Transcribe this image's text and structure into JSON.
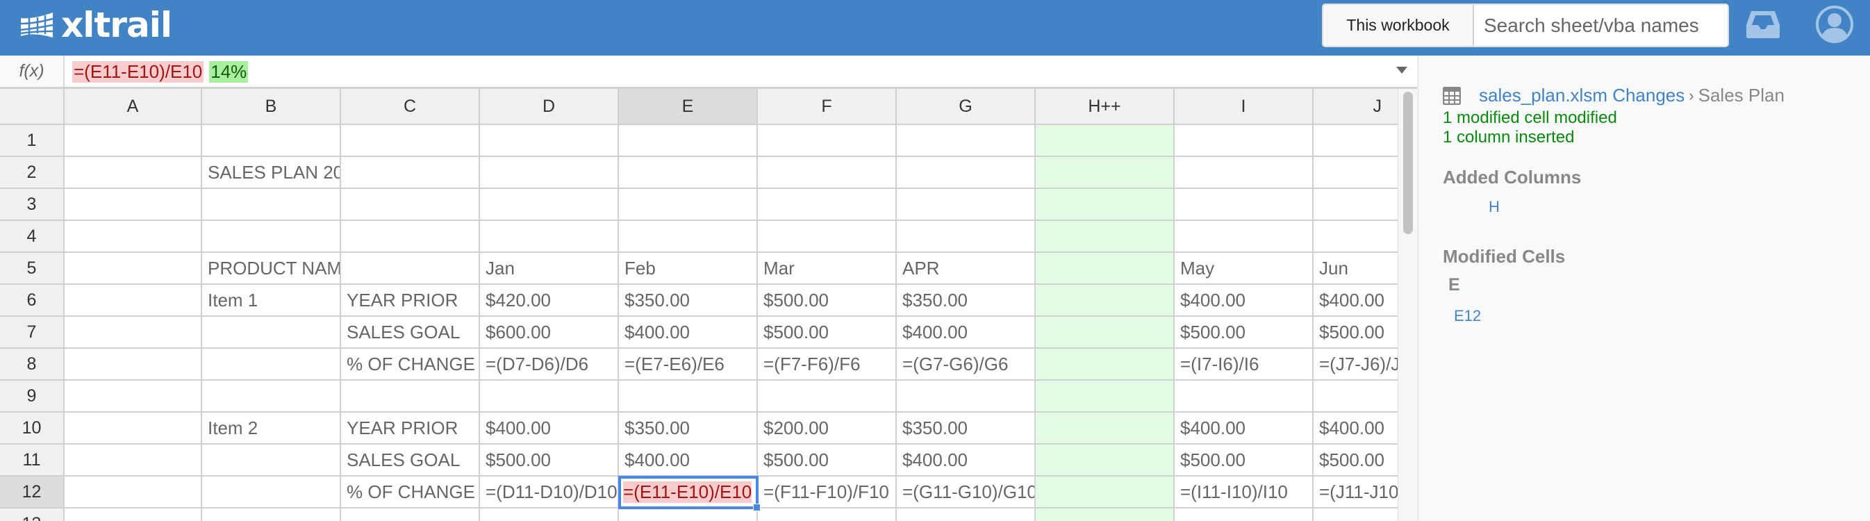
{
  "header": {
    "brand": "xltrail",
    "scope_button": "This workbook",
    "search_placeholder": "Search sheet/vba names",
    "icons": [
      "logo-grid-icon",
      "inbox-icon",
      "user-avatar-icon"
    ]
  },
  "formula_bar": {
    "label": "f(x)",
    "old_value": "=(E11-E10)/E10",
    "new_value": "14%"
  },
  "grid": {
    "columns": [
      "A",
      "B",
      "C",
      "D",
      "E",
      "F",
      "G",
      "H++",
      "I",
      "J"
    ],
    "selected_column": "E",
    "added_column": "H++",
    "rows": [
      {
        "num": "1",
        "cells": [
          "",
          "",
          "",
          "",
          "",
          "",
          "",
          "",
          "",
          ""
        ]
      },
      {
        "num": "2",
        "cells": [
          "",
          "SALES PLAN 20",
          "",
          "",
          "",
          "",
          "",
          "",
          "",
          ""
        ]
      },
      {
        "num": "3",
        "cells": [
          "",
          "",
          "",
          "",
          "",
          "",
          "",
          "",
          "",
          ""
        ]
      },
      {
        "num": "4",
        "cells": [
          "",
          "",
          "",
          "",
          "",
          "",
          "",
          "",
          "",
          ""
        ]
      },
      {
        "num": "5",
        "cells": [
          "",
          "PRODUCT NAM",
          "",
          "Jan",
          "Feb",
          "Mar",
          "APR",
          "",
          "May",
          "Jun"
        ]
      },
      {
        "num": "6",
        "cells": [
          "",
          "Item 1",
          "YEAR PRIOR",
          "$420.00",
          "$350.00",
          "$500.00",
          "$350.00",
          "",
          "$400.00",
          "$400.00"
        ]
      },
      {
        "num": "7",
        "cells": [
          "",
          "",
          "SALES GOAL",
          "$600.00",
          "$400.00",
          "$500.00",
          "$400.00",
          "",
          "$500.00",
          "$500.00"
        ]
      },
      {
        "num": "8",
        "cells": [
          "",
          "",
          "% OF CHANGE",
          "=(D7-D6)/D6",
          "=(E7-E6)/E6",
          "=(F7-F6)/F6",
          "=(G7-G6)/G6",
          "",
          "=(I7-I6)/I6",
          "=(J7-J6)/J6"
        ]
      },
      {
        "num": "9",
        "cells": [
          "",
          "",
          "",
          "",
          "",
          "",
          "",
          "",
          "",
          ""
        ]
      },
      {
        "num": "10",
        "cells": [
          "",
          "Item 2",
          "YEAR PRIOR",
          "$400.00",
          "$350.00",
          "$200.00",
          "$350.00",
          "",
          "$400.00",
          "$400.00"
        ]
      },
      {
        "num": "11",
        "cells": [
          "",
          "",
          "SALES GOAL",
          "$500.00",
          "$400.00",
          "$500.00",
          "$400.00",
          "",
          "$500.00",
          "$500.00"
        ]
      },
      {
        "num": "12",
        "cells": [
          "",
          "",
          "% OF CHANGE",
          "=(D11-D10)/D10",
          "=(E11-E10)/E10",
          "=(F11-F10)/F10",
          "=(G11-G10)/G10",
          "",
          "=(I11-I10)/I10",
          "=(J11-J10)/J10"
        ]
      },
      {
        "num": "13",
        "cells": [
          "",
          "",
          "",
          "",
          "",
          "",
          "",
          "",
          "",
          ""
        ]
      }
    ],
    "selected_cell": {
      "row": "12",
      "col": "E"
    }
  },
  "panel": {
    "file_link": "sales_plan.xlsm Changes",
    "separator": "›",
    "sheet_name": "Sales Plan",
    "summary": [
      "1 modified cell modified",
      "1 column inserted"
    ],
    "added_columns_title": "Added Columns",
    "added_columns": [
      "H"
    ],
    "modified_cells_title": "Modified Cells",
    "modified_groups": [
      {
        "column": "E",
        "cells": [
          "E12"
        ]
      }
    ]
  },
  "colors": {
    "brand": "#4183c4",
    "added": "#e3fce3",
    "removed_bg": "#f8cccc",
    "added_bg": "#a8f0a0",
    "summary_green": "#0a8a0a",
    "selection": "#4a86e8"
  }
}
